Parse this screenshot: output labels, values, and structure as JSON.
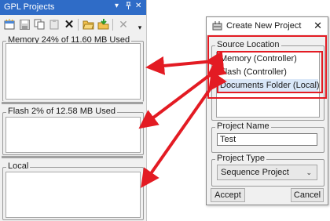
{
  "panel": {
    "title": "GPL Projects",
    "title_buttons": [
      "▾",
      "ᵖ",
      "✕"
    ],
    "toolbar": [
      {
        "icon": "new-project-icon"
      },
      {
        "icon": "save-icon"
      },
      {
        "icon": "copy-icon"
      },
      {
        "icon": "paste-icon"
      },
      {
        "icon": "delete-icon",
        "glyph": "✕"
      },
      {
        "icon": "open-folder-icon"
      },
      {
        "icon": "import-icon"
      },
      {
        "icon": "close-icon",
        "glyph": "✕"
      },
      {
        "icon": "overflow-icon",
        "glyph": "▾"
      }
    ],
    "groups": {
      "memory": "Memory 24% of 11.60 MB Used",
      "flash": "Flash 2% of 12.58 MB Used",
      "local": "Local"
    }
  },
  "dialog": {
    "title": "Create New Project",
    "close": "✕",
    "source_location": {
      "label": "Source Location",
      "options": [
        "Memory (Controller)",
        "Flash (Controller)",
        "Documents Folder (Local)"
      ],
      "selected_index": 2
    },
    "project_name": {
      "label": "Project Name",
      "value": "Test"
    },
    "project_type": {
      "label": "Project Type",
      "value": "Sequence Project"
    },
    "accept": "Accept",
    "cancel": "Cancel"
  },
  "annotation_color": "#e31b23"
}
